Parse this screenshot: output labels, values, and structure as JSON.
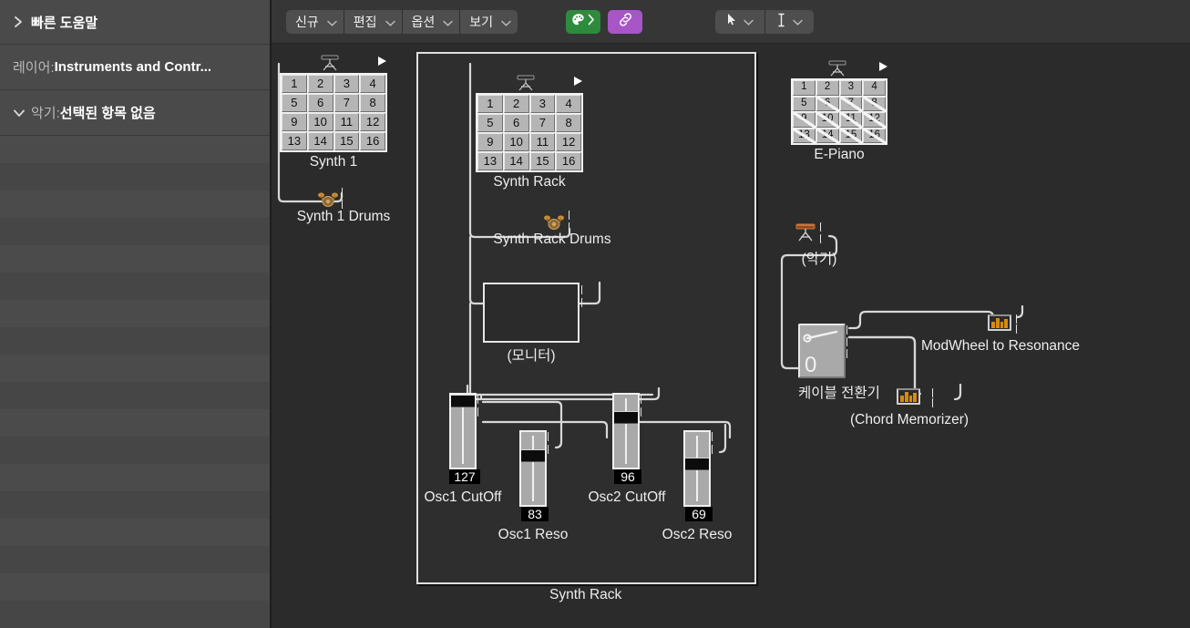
{
  "sidebar": {
    "rows": [
      {
        "id": "quick-help",
        "disclosure": "collapsed",
        "label": "빠른 도움말",
        "prefix": ""
      },
      {
        "id": "layer",
        "disclosure": "none",
        "prefix": "레이어: ",
        "label": "Instruments and Contr..."
      },
      {
        "id": "instrument",
        "disclosure": "expanded",
        "prefix": "악기: ",
        "label": "선택된 항목 없음"
      }
    ]
  },
  "toolbar": {
    "menus": [
      {
        "id": "new",
        "label": "신규"
      },
      {
        "id": "edit",
        "label": "편집"
      },
      {
        "id": "option",
        "label": "옵션"
      },
      {
        "id": "view",
        "label": "보기"
      }
    ],
    "buttons": [
      {
        "id": "colors",
        "icon": "palette-icon",
        "color": "#2e8b3d"
      },
      {
        "id": "link",
        "icon": "link-icon",
        "color": "#a855c8"
      }
    ],
    "tools": [
      {
        "id": "pointer",
        "icon": "pointer-tool-icon"
      },
      {
        "id": "text",
        "icon": "text-tool-icon"
      }
    ]
  },
  "canvas": {
    "rack_container": {
      "label": "Synth Rack"
    },
    "nodes": [
      {
        "id": "synth1",
        "label": "Synth 1",
        "type": "grid16",
        "icon": "keyboard-stand-icon"
      },
      {
        "id": "synth1-drums",
        "label": "Synth 1 Drums",
        "type": "icon-node",
        "icon": "drumkit-icon"
      },
      {
        "id": "synth-rack",
        "label": "Synth Rack",
        "type": "grid16",
        "icon": "keyboard-stand-icon"
      },
      {
        "id": "synth-rack-drums",
        "label": "Synth Rack Drums",
        "type": "icon-node",
        "icon": "drumkit-icon"
      },
      {
        "id": "e-piano",
        "label": "E-Piano",
        "type": "grid16",
        "icon": "keyboard-stand-icon"
      },
      {
        "id": "monitor",
        "label": "(모니터)",
        "type": "box"
      },
      {
        "id": "instrument-generic",
        "label": "(악기)",
        "type": "icon-node",
        "icon": "keyboard-stand-icon"
      },
      {
        "id": "cable-switcher",
        "label": "케이블 전환기",
        "type": "switcher",
        "value": "0"
      },
      {
        "id": "modwheel-to-resonance",
        "label": "ModWheel to Resonance",
        "type": "chip",
        "icon": "transformer-chip-icon"
      },
      {
        "id": "chord-memorizer",
        "label": "(Chord Memorizer)",
        "type": "chip",
        "icon": "transformer-chip-icon"
      }
    ],
    "grid_cells": [
      "1",
      "2",
      "3",
      "4",
      "5",
      "6",
      "7",
      "8",
      "9",
      "10",
      "11",
      "12",
      "13",
      "14",
      "15",
      "16"
    ],
    "epiano_active_cells": [
      "1",
      "2",
      "3",
      "4",
      "5"
    ],
    "faders": [
      {
        "id": "osc1-cutoff",
        "label": "Osc1 CutOff",
        "value": "127"
      },
      {
        "id": "osc1-reso",
        "label": "Osc1 Reso",
        "value": "83"
      },
      {
        "id": "osc2-cutoff",
        "label": "Osc2 CutOff",
        "value": "96"
      },
      {
        "id": "osc2-reso",
        "label": "Osc2 Reso",
        "value": "69"
      }
    ]
  },
  "colors": {
    "sidebar_bg": "#4a4a4a",
    "canvas_bg": "#2b2b2b",
    "toolbar_bg": "#363636",
    "accent_green": "#2e8b3d",
    "accent_purple": "#a855c8",
    "wire": "#e6e6e6",
    "chip_amber": "#d88a12"
  }
}
